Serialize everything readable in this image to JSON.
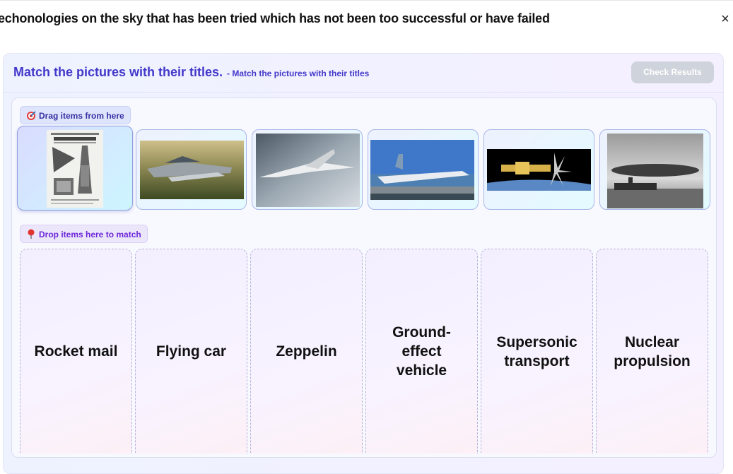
{
  "window": {
    "title": "echonologies on the sky that has been tried which has not been too successful or have failed",
    "close_glyph": "×"
  },
  "activity": {
    "title": "Match the pictures with their titles.",
    "subtitle": "- Match the pictures with their titles",
    "check_button": "Check Results"
  },
  "drag_section": {
    "label": "Drag items from here",
    "icon": "target-dart-icon"
  },
  "drop_section": {
    "label": "Drop items here to match",
    "icon": "pushpin-icon"
  },
  "draggables": [
    {
      "name": "rocket-mail-newspaper-picture",
      "selected": true
    },
    {
      "name": "flying-car-picture",
      "selected": false
    },
    {
      "name": "concorde-picture",
      "selected": false
    },
    {
      "name": "ekranoplan-picture",
      "selected": false
    },
    {
      "name": "nuclear-spacecraft-picture",
      "selected": false
    },
    {
      "name": "zeppelin-airship-picture",
      "selected": false
    }
  ],
  "targets": [
    {
      "label": "Rocket mail"
    },
    {
      "label": "Flying car"
    },
    {
      "label": "Zeppelin"
    },
    {
      "label": "Ground-effect vehicle"
    },
    {
      "label": "Supersonic transport"
    },
    {
      "label": "Nuclear propulsion"
    }
  ],
  "colors": {
    "accent": "#4338ca",
    "drop_accent": "#6d28d9",
    "button_disabled": "#cfd3db"
  }
}
